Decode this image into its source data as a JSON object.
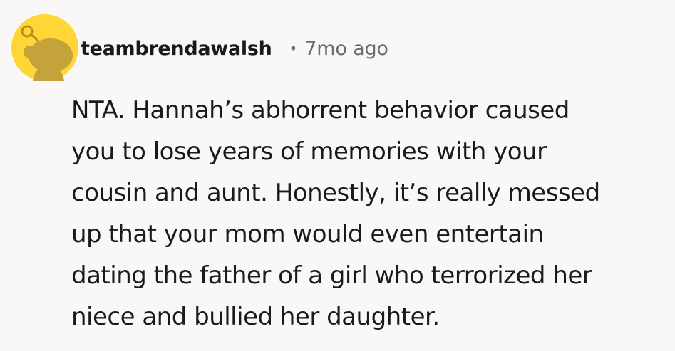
{
  "comment": {
    "author": "teambrendawalsh",
    "separator": "•",
    "timestamp": "7mo ago",
    "body_lines": [
      "NTA. Hannah’s abhorrent behavior caused",
      "you to lose years of memories with your",
      "cousin and aunt. Honestly, it’s really messed",
      "up that your mom would even entertain",
      "dating the father of a girl who terrorized her",
      "niece and bullied her daughter."
    ],
    "avatar_icon": "snoo-avatar-icon"
  },
  "colors": {
    "background": "#f9f8f7",
    "avatar_yellow": "#ffd635",
    "avatar_figure": "#c4a33a",
    "text": "#1a1a1b",
    "meta": "#6a6e71"
  }
}
